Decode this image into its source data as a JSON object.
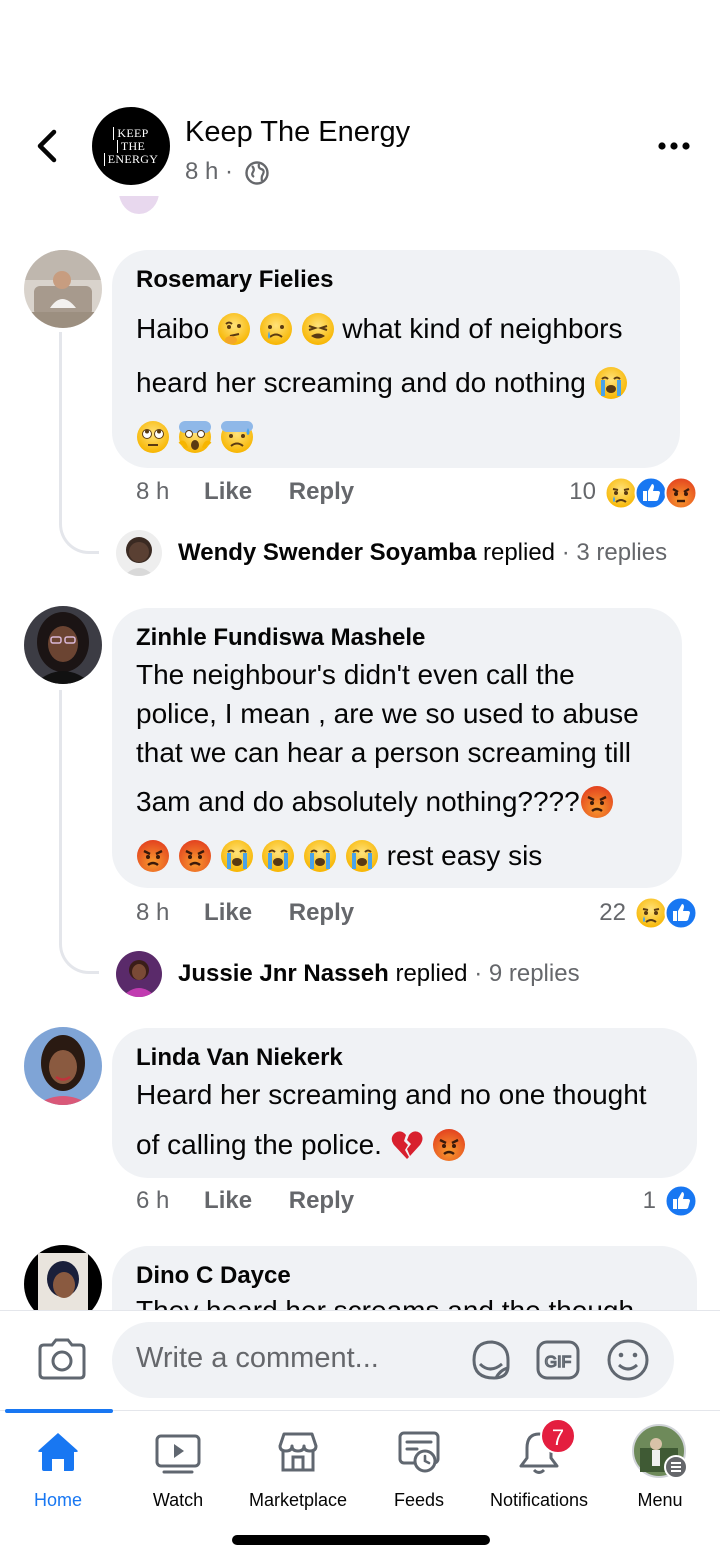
{
  "header": {
    "page_name": "Keep The Energy",
    "post_time": "8 h ·",
    "logo_lines": [
      "KEEP",
      "THE",
      "ENERGY"
    ]
  },
  "comments": [
    {
      "author": "Rosemary Fielies",
      "line1": "Haibo",
      "line1b": "what kind of neighbors",
      "line2": "heard her screaming and do nothing",
      "time": "8 h",
      "like": "Like",
      "reply": "Reply",
      "reaction_count": "10",
      "reply_preview": {
        "name": "Wendy Swender Soyamba",
        "verb": "replied",
        "count": "· 3 replies"
      }
    },
    {
      "author": "Zinhle Fundiswa Mashele",
      "line1": "The neighbour's didn't even call the",
      "line2": "police, I mean , are we so used to abuse",
      "line3": "that we can hear a person screaming till",
      "line4": "3am and do absolutely nothing????",
      "line5": "rest easy sis",
      "time": "8 h",
      "like": "Like",
      "reply": "Reply",
      "reaction_count": "22",
      "reply_preview": {
        "name": "Jussie Jnr Nasseh",
        "verb": "replied",
        "count": "· 9 replies"
      }
    },
    {
      "author": "Linda Van Niekerk",
      "line1": "Heard her screaming and no one thought",
      "line2": "of calling the police.",
      "time": "6 h",
      "like": "Like",
      "reply": "Reply",
      "reaction_count": "1"
    },
    {
      "author": "Dino C Dayce",
      "line1": "They heard her screams and the though"
    }
  ],
  "composer": {
    "placeholder": "Write a comment..."
  },
  "nav": {
    "items": [
      {
        "label": "Home"
      },
      {
        "label": "Watch"
      },
      {
        "label": "Marketplace"
      },
      {
        "label": "Feeds"
      },
      {
        "label": "Notifications"
      },
      {
        "label": "Menu"
      }
    ],
    "notifications_badge": "7"
  },
  "colors": {
    "accent": "#1877f2",
    "badge": "#e41e3f",
    "bubble": "#f0f2f5",
    "secondary_text": "#65676b"
  }
}
